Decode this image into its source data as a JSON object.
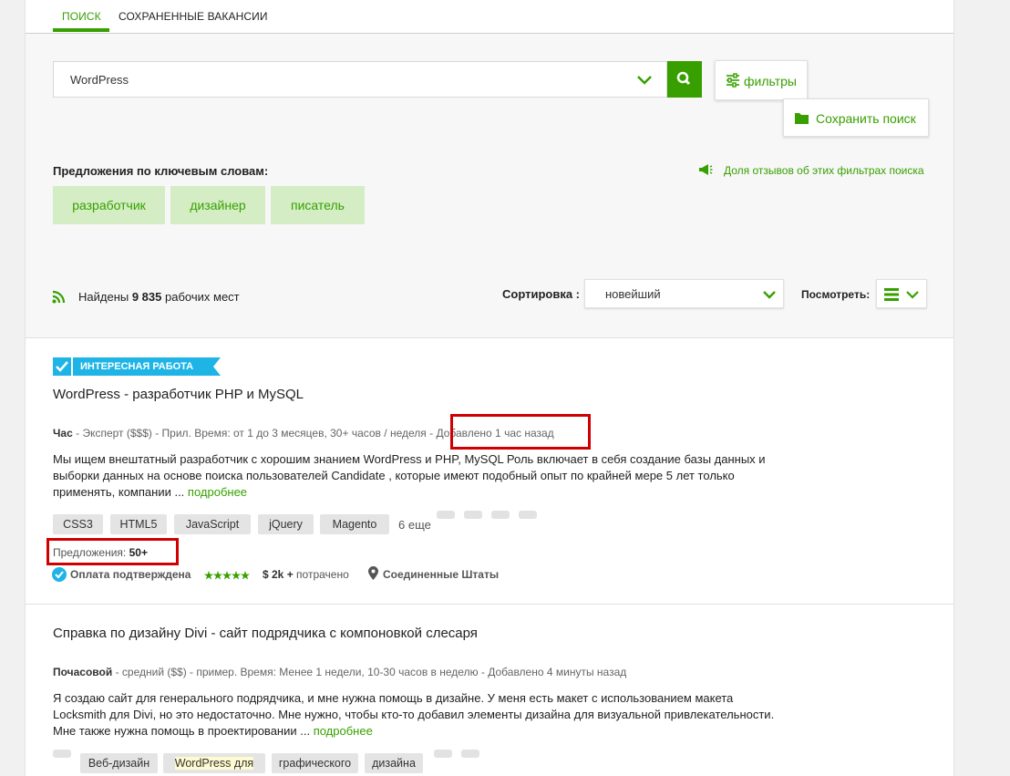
{
  "tabs": [
    {
      "label": "ПОИСК",
      "active": true
    },
    {
      "label": "СОХРАНЕННЫЕ ВАКАНСИИ",
      "active": false
    }
  ],
  "search": {
    "value": "WordPress",
    "filters_label": "фильтры",
    "save_label": "Сохранить поиск"
  },
  "suggestions": {
    "title": "Предложения по ключевым словам:",
    "chips": [
      "разработчик",
      "дизайнер",
      "писатель"
    ],
    "feedback_label": "Доля отзывов об этих фильтрах поиска"
  },
  "results": {
    "found_prefix": "Найдены",
    "count": "9 835",
    "found_suffix": "рабочих мест",
    "sort_label": "Сортировка :",
    "sort_value": "новейший",
    "view_label": "Посмотреть:"
  },
  "jobs": [
    {
      "badge": "ИНТЕРЕСНАЯ РАБОТА",
      "title_prefix": "WordPress -",
      "title_rest": "разработчик PHP и MySQL",
      "type": "Час",
      "meta": "- Эксперт ($$$) - Прил. Время: от 1 до 3 месяцев, 30+ часов / неделя -",
      "posted": "Добавлено 1 час назад",
      "description": "Мы ищем внештатный разработчик с хорошим знанием WordPress и PHP, MySQL Роль включает в себя создание базы данных и выборки данных на основе поиска пользователей Candidate , которые имеют подобный опыт по крайней мере 5 лет только применять, компании ...",
      "more": "подробнее",
      "skills": [
        "CSS3",
        "HTML5",
        "JavaScript",
        "jQuery",
        "Magento"
      ],
      "more_skills": "6 еще",
      "proposals_label": "Предложения:",
      "proposals": "50+",
      "payment": "Оплата подтверждена",
      "spent": "$ 2k +",
      "spent_label": "потрачено",
      "location": "Соединенные Штаты"
    },
    {
      "title_prefix": "Справка по дизайну",
      "title_bold": "Divi -",
      "title_rest": "сайт подрядчика с компоновкой слесаря",
      "type": "Почасовой",
      "meta": "- средний ($$) - пример. Время: Менее 1 недели, 10-30 часов в неделю - Добавлено 4 минуты назад",
      "description": "Я создаю сайт для генерального подрядчика, и мне нужна помощь в дизайне. У меня есть макет с использованием макета Locksmith для Divi, но это недостаточно. Мне нужно, чтобы кто-то добавил элементы дизайна для визуальной привлекательности. Мне также нужна помощь в проектировании ...",
      "more": "подробнее",
      "skills": [
        "Веб-дизайн",
        "WordPress для",
        "графического",
        "дизайна"
      ]
    }
  ],
  "colors": {
    "accent": "#37a000",
    "chip_bg": "#d4edc5",
    "badge": "#1fb4e6",
    "highlight": "#d00000"
  }
}
